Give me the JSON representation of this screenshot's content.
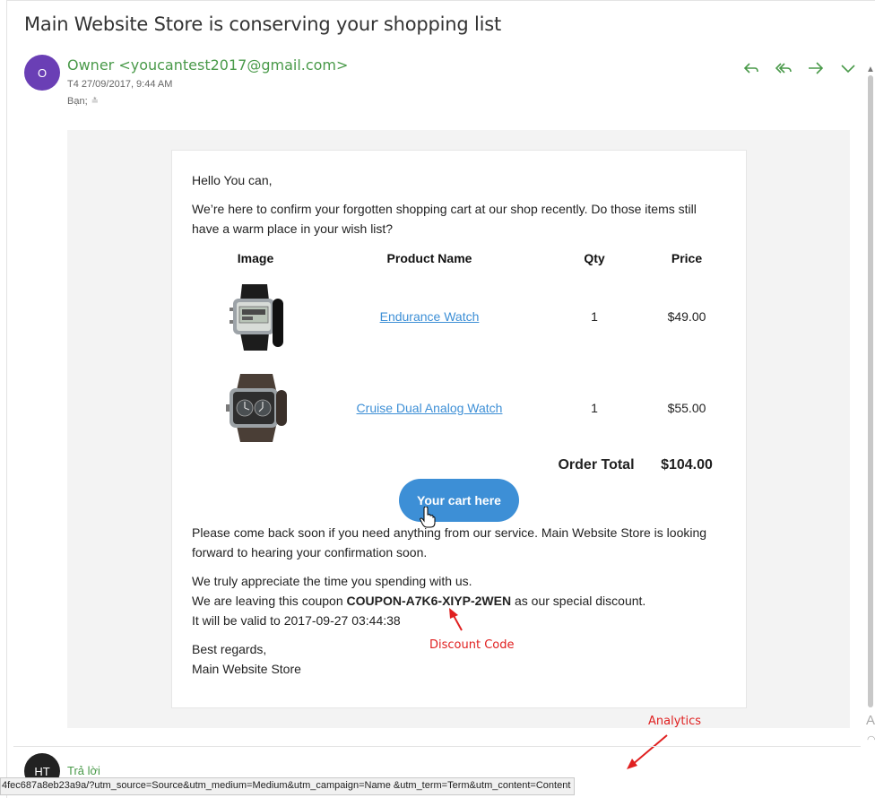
{
  "email": {
    "subject": "Main Website Store is conserving your shopping list",
    "sender_initial": "O",
    "sender": "Owner <youcantest2017@gmail.com>",
    "date": "T4 27/09/2017, 9:44 AM",
    "recipient": "Bạn;",
    "actions": [
      {
        "name": "reply",
        "icon": "reply-icon"
      },
      {
        "name": "reply-all",
        "icon": "reply-all-icon"
      },
      {
        "name": "forward",
        "icon": "forward-icon"
      },
      {
        "name": "more",
        "icon": "chevron-down-icon"
      }
    ]
  },
  "body": {
    "greeting": "Hello You can,",
    "intro": "We’re here to confirm your forgotten shopping cart at our shop recently. Do those items still have a warm place in your wish list?",
    "table": {
      "headers": [
        "Image",
        "Product Name",
        "Qty",
        "Price"
      ],
      "rows": [
        {
          "name": "Endurance Watch",
          "qty": "1",
          "price": "$49.00",
          "image_icon": "digital-watch-image"
        },
        {
          "name": "Cruise Dual Analog Watch",
          "qty": "1",
          "price": "$55.00",
          "image_icon": "analog-watch-image"
        }
      ],
      "total_label": "Order Total",
      "total_value": "$104.00"
    },
    "cta_label": "Your cart here",
    "comeback": "Please come back soon if you need anything from our service. Main Website Store is looking forward to hearing your confirmation soon.",
    "appreciate": "We truly appreciate the time you spending with us.",
    "coupon_prefix": "We are leaving this coupon ",
    "coupon_code": "COUPON-A7K6-XIYP-2WEN",
    "coupon_suffix": " as our special discount.",
    "valid_until": "It will be valid to 2017-09-27 03:44:38",
    "regards": "Best regards,",
    "store_signature": "Main Website Store"
  },
  "annotations": {
    "discount": "Discount Code",
    "analytics": "Analytics",
    "color": "#e02020"
  },
  "footer": {
    "reply_initials": "HT",
    "reply_label": "Trả lời"
  },
  "status_bar": {
    "url": "4fec687a8eb23a9a/?utm_source=Source&utm_medium=Medium&utm_campaign=Name &utm_term=Term&utm_content=Content"
  },
  "colors": {
    "accent_blue": "#3d8fd6",
    "sender_green": "#4a9a4a",
    "avatar_purple": "#6a3fb5"
  }
}
